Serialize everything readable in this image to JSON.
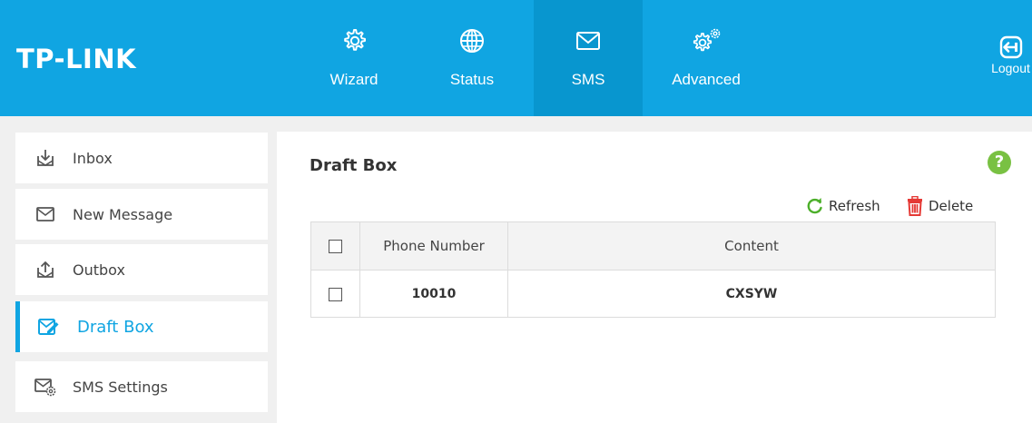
{
  "header": {
    "logo": "TP-LINK",
    "nav": [
      {
        "id": "wizard",
        "label": "Wizard",
        "icon": "gear-icon"
      },
      {
        "id": "status",
        "label": "Status",
        "icon": "globe-icon"
      },
      {
        "id": "sms",
        "label": "SMS",
        "icon": "envelope-icon",
        "active": true
      },
      {
        "id": "advanced",
        "label": "Advanced",
        "icon": "double-gear-icon"
      }
    ],
    "logout_label": "Logout"
  },
  "sidebar": {
    "items": [
      {
        "label": "Inbox",
        "icon": "inbox-icon"
      },
      {
        "label": "New Message",
        "icon": "envelope-icon"
      },
      {
        "label": "Outbox",
        "icon": "outbox-icon"
      },
      {
        "label": "Draft Box",
        "icon": "draft-icon",
        "active": true
      },
      {
        "label": "SMS Settings",
        "icon": "sms-settings-icon"
      }
    ]
  },
  "main": {
    "title": "Draft Box",
    "help": "?",
    "toolbar": {
      "refresh_label": "Refresh",
      "delete_label": "Delete"
    },
    "table": {
      "columns": [
        "",
        "Phone Number",
        "Content"
      ],
      "rows": [
        {
          "phone": "10010",
          "content": "CXSYW"
        }
      ]
    }
  },
  "colors": {
    "header_bg": "#10a5e2",
    "nav_active_bg": "#0896cf",
    "accent": "#10a5e2",
    "help_green": "#79c143",
    "refresh_green": "#4caf2a",
    "delete_red": "#e53935"
  }
}
